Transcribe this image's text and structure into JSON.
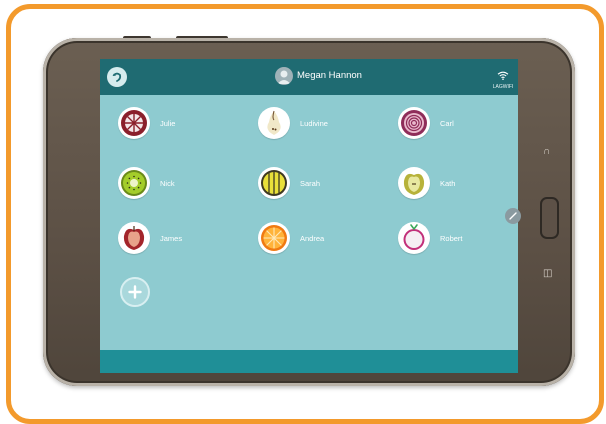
{
  "header": {
    "user_name": "Megan Hannon",
    "wifi_label": "LAGWIFI"
  },
  "profiles": [
    {
      "name": "Julie",
      "fruit": "mangosteen-icon"
    },
    {
      "name": "Ludivine",
      "fruit": "pear-icon"
    },
    {
      "name": "Carl",
      "fruit": "onion-icon"
    },
    {
      "name": "Nick",
      "fruit": "kiwi-icon"
    },
    {
      "name": "Sarah",
      "fruit": "lemon-icon"
    },
    {
      "name": "Kath",
      "fruit": "apple-icon"
    },
    {
      "name": "James",
      "fruit": "red-apple-icon"
    },
    {
      "name": "Andrea",
      "fruit": "orange-icon"
    },
    {
      "name": "Robert",
      "fruit": "turnip-icon"
    }
  ],
  "colors": {
    "frame": "#f39a2c",
    "topbar": "#1f6b72",
    "screen_bg": "#8ecbd0",
    "bottombar": "#1f8f97"
  }
}
